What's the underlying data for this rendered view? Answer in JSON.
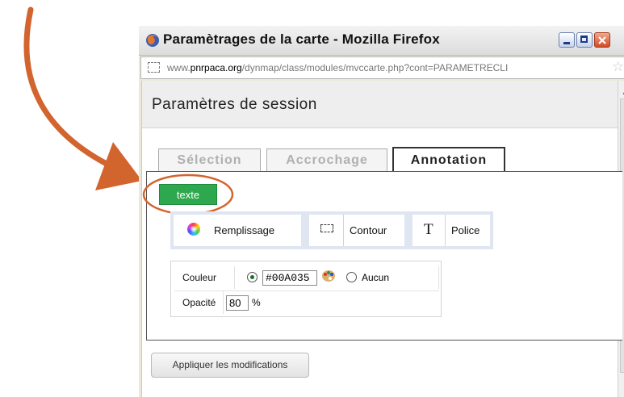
{
  "window": {
    "title": "Paramètrages de la carte - Mozilla Firefox",
    "url_prefix": "www.",
    "url_domain": "pnrpaca.org",
    "url_path": "/dynmap/class/modules/mvccarte.php?cont=PARAMETRECLI"
  },
  "header": {
    "title": "Paramètres de session"
  },
  "tabs": [
    {
      "label": "Sélection",
      "active": false
    },
    {
      "label": "Accrochage",
      "active": false
    },
    {
      "label": "Annotation",
      "active": true
    }
  ],
  "annotation": {
    "mode_button": "texte",
    "mode_color": "#2ea84e",
    "subtabs": [
      {
        "label": "Remplissage",
        "icon": "color-wheel-icon"
      },
      {
        "label": "Contour",
        "icon": "dashed-rectangle-icon"
      },
      {
        "label": "Police",
        "icon": "font-t-icon"
      }
    ],
    "properties": {
      "color_label": "Couleur",
      "color_value": "#00A035",
      "none_label": "Aucun",
      "color_selected": true,
      "opacity_label": "Opacité",
      "opacity_value": "80",
      "opacity_unit": "%"
    }
  },
  "apply_button": "Appliquer les modifications",
  "highlight_color": "#d2642e"
}
